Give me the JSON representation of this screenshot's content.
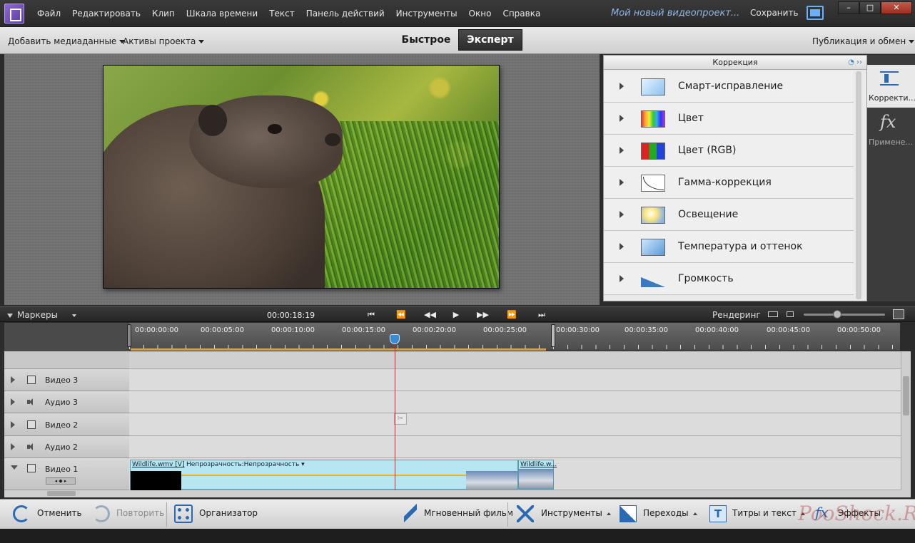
{
  "menu": {
    "items": [
      "Файл",
      "Редактировать",
      "Клип",
      "Шкала времени",
      "Текст",
      "Панель действий",
      "Инструменты",
      "Окно",
      "Справка"
    ],
    "project_title": "Мой новый видеопроект...",
    "save_label": "Сохранить"
  },
  "window_controls": {
    "minimize": "–",
    "maximize": "□",
    "close": "✕"
  },
  "toolbar": {
    "add_media": "Добавить медиаданные",
    "project_assets": "Активы проекта",
    "mode_quick": "Быстрое",
    "mode_expert": "Эксперт",
    "publish": "Публикация и обмен"
  },
  "correction_panel": {
    "title": "Коррекция",
    "header_icons": "◔ ››",
    "items": [
      {
        "label": "Смарт-исправление",
        "icon": "smart-fix-icon"
      },
      {
        "label": "Цвет",
        "icon": "color-icon"
      },
      {
        "label": "Цвет (RGB)",
        "icon": "color-rgb-icon"
      },
      {
        "label": "Гамма-коррекция",
        "icon": "gamma-icon"
      },
      {
        "label": "Освещение",
        "icon": "lighting-icon"
      },
      {
        "label": "Температура и оттенок",
        "icon": "temperature-icon"
      },
      {
        "label": "Громкость",
        "icon": "volume-icon"
      }
    ]
  },
  "side_tabs": {
    "adjust": "Корректи...",
    "applied": "Примене...",
    "applied_symbol": "fx"
  },
  "timeline_header": {
    "markers": "Маркеры",
    "timecode": "00:00:18:19",
    "transport": [
      "⏮",
      "⏪",
      "◀◀",
      "▶",
      "▶▶",
      "⏩",
      "⏭"
    ],
    "render": "Рендеринг"
  },
  "ruler": {
    "labels": [
      "00:00:00:00",
      "00:00:05:00",
      "00:00:10:00",
      "00:00:15:00",
      "00:00:20:00",
      "00:00:25:00",
      "00:00:30:00",
      "00:00:35:00",
      "00:00:40:00",
      "00:00:45:00",
      "00:00:50:00"
    ]
  },
  "tracks": [
    {
      "name": "Видео 3",
      "type": "video"
    },
    {
      "name": "Аудио 3",
      "type": "audio"
    },
    {
      "name": "Видео 2",
      "type": "video"
    },
    {
      "name": "Аудио 2",
      "type": "audio"
    },
    {
      "name": "Видео 1",
      "type": "video"
    }
  ],
  "clips": {
    "main_name": "Wildlife.wmv [V]",
    "main_property": "Непрозрачность:Непрозрачность ▾",
    "second_name": "Wildlife.w..."
  },
  "keyframe_ctrl": "◂ ◆ ▸",
  "scissors": "✂",
  "bottom_bar": {
    "undo": "Отменить",
    "redo": "Повторить",
    "organizer": "Организатор",
    "instant_movie": "Мгновенный фильм",
    "tools": "Инструменты",
    "transitions": "Переходы",
    "titles": "Титры и текст",
    "titles_symbol": "T",
    "effects": "Эффекты",
    "effects_symbol": "fx"
  },
  "watermark": "PooShock.Ru",
  "colors": {
    "accent": "#2a6ab5",
    "playhead": "#e02020",
    "work_area": "#f0a020",
    "clip": "#b6e6f2"
  }
}
